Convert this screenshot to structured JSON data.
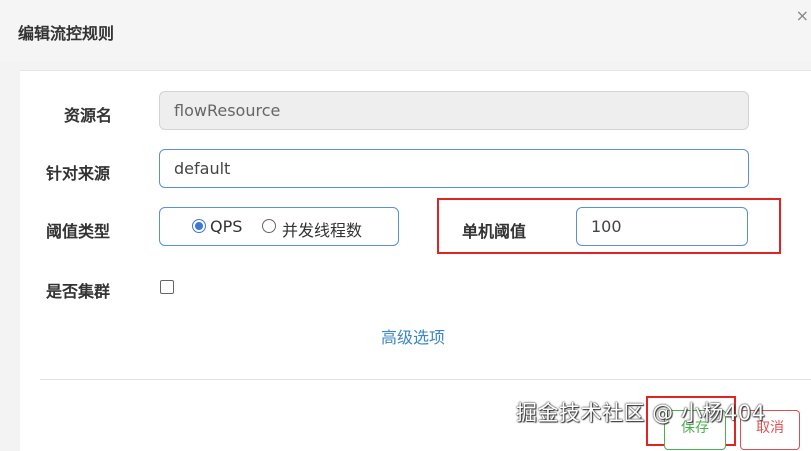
{
  "dialog": {
    "title": "编辑流控规则",
    "close_glyph": "×"
  },
  "form": {
    "resource_name": {
      "label": "资源名",
      "value": "flowResource"
    },
    "limit_app": {
      "label": "针对来源",
      "value": "default"
    },
    "grade": {
      "label": "阈值类型",
      "options": [
        {
          "label": "QPS",
          "checked": true
        },
        {
          "label": "并发线程数",
          "checked": false
        }
      ]
    },
    "count": {
      "label": "单机阈值",
      "value": "100"
    },
    "cluster": {
      "label": "是否集群",
      "checked": false
    },
    "advanced_link": "高级选项"
  },
  "footer": {
    "save_label": "保存",
    "cancel_label": "取消"
  },
  "watermark": "掘金技术社区 @ 小杨404",
  "colors": {
    "highlight": "#e02424",
    "input_border": "#5b8fd6",
    "link": "#3b86c9",
    "save": "#4caf50",
    "cancel": "#e05050"
  }
}
